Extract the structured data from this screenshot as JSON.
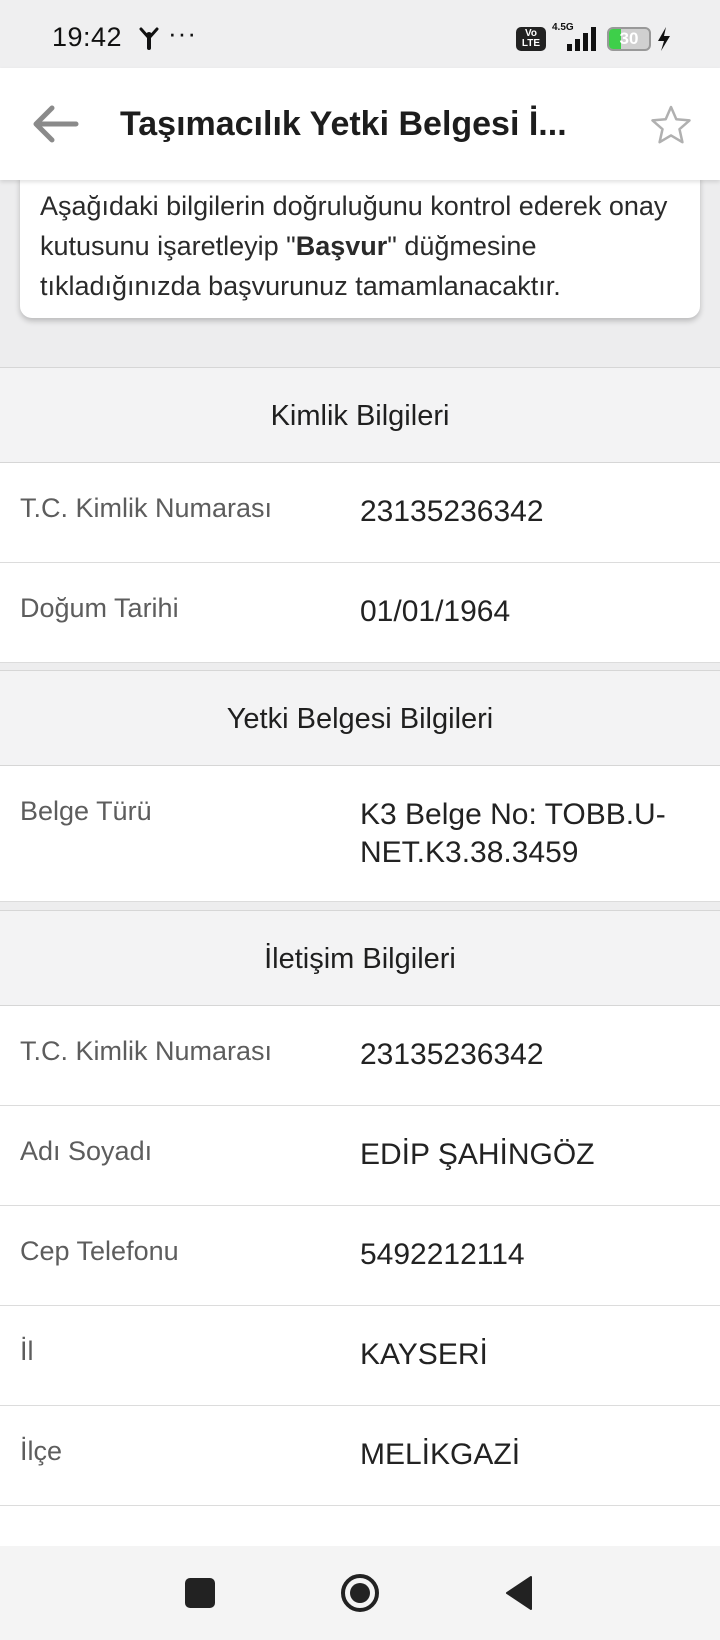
{
  "status_bar": {
    "time": "19:42",
    "more": "···",
    "volte": "Vo LTE",
    "network": "4.5G",
    "battery_level": 30,
    "battery_text": "30",
    "battery_color": "#3ecf4a"
  },
  "app_bar": {
    "title": "Taşımacılık Yetki Belgesi İ...",
    "back_icon": "arrow-left-icon",
    "favorite_icon": "star-outline-icon"
  },
  "info_card": {
    "line_before": "Aşağıdaki bilgilerin doğruluğunu kontrol ederek onay kutusunu işaretleyip \"",
    "bold_word": "Başvur",
    "line_after": "\" düğmesine tıkladığınızda başvurunuz tamamlanacaktır."
  },
  "sections": {
    "identity": {
      "title": "Kimlik Bilgileri",
      "rows": [
        {
          "label": "T.C. Kimlik Numarası",
          "value": "23135236342"
        },
        {
          "label": "Doğum Tarihi",
          "value": "01/01/1964"
        }
      ]
    },
    "license": {
      "title": "Yetki Belgesi Bilgileri",
      "rows": [
        {
          "label": "Belge Türü",
          "value": "K3 Belge No: TOBB.U-NET.K3.38.3459"
        }
      ]
    },
    "contact": {
      "title": "İletişim Bilgileri",
      "rows": [
        {
          "label": "T.C. Kimlik Numarası",
          "value": "23135236342"
        },
        {
          "label": "Adı Soyadı",
          "value": "EDİP ŞAHİNGÖZ"
        },
        {
          "label": "Cep Telefonu",
          "value": "5492212114"
        },
        {
          "label": "İl",
          "value": "KAYSERİ"
        },
        {
          "label": "İlçe",
          "value": "MELİKGAZİ"
        }
      ]
    }
  },
  "nav_bar": {
    "recents_icon": "square-icon",
    "home_icon": "circle-home-icon",
    "back_icon": "triangle-back-icon"
  }
}
